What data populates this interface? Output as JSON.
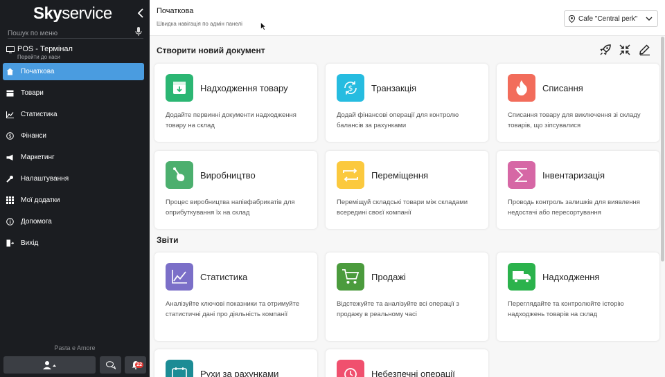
{
  "sidebar": {
    "logo_bold": "Sky",
    "logo_light": "service",
    "search_placeholder": "Пошук по меню",
    "pos": {
      "title": "POS - Термінал",
      "subtitle": "Перейти до каси"
    },
    "items": [
      {
        "label": "Початкова",
        "icon": "home-icon"
      },
      {
        "label": "Товари",
        "icon": "box-icon"
      },
      {
        "label": "Статистика",
        "icon": "chart-icon"
      },
      {
        "label": "Фінанси",
        "icon": "finance-icon"
      },
      {
        "label": "Маркетинг",
        "icon": "megaphone-icon"
      },
      {
        "label": "Налаштування",
        "icon": "wrench-icon"
      },
      {
        "label": "Мої додатки",
        "icon": "grid-icon"
      },
      {
        "label": "Допомога",
        "icon": "info-icon"
      },
      {
        "label": "Вихід",
        "icon": "logout-icon"
      }
    ],
    "company": "Pasta e Amore",
    "notifications_count": "22"
  },
  "header": {
    "title": "Початкова",
    "subtitle": "Швидка навігація по адмін панелі",
    "location": "Cafe \"Central perk\""
  },
  "main": {
    "create_title": "Створити новий документ",
    "reports_title": "Звіти",
    "docs": [
      {
        "title": "Надходження товару",
        "desc": "Додайте первинні документи надходження товару на склад",
        "color": "#2bb673"
      },
      {
        "title": "Транзакція",
        "desc": "Додай фінансові операції для контролю балансів за рахунками",
        "color": "#26bce0"
      },
      {
        "title": "Списання",
        "desc": "Списання товару для виключення зі складу товарів, що зіпсувалися",
        "color": "#f26c5b"
      },
      {
        "title": "Виробництво",
        "desc": "Процес виробництва напівфабрикатів для оприбуткування їх на склад",
        "color": "#4caf6e"
      },
      {
        "title": "Переміщення",
        "desc": "Переміщуй складські товари між складами всередині своєї компанії",
        "color": "#fbc93e"
      },
      {
        "title": "Інвентаризація",
        "desc": "Проводь контроль залишків для виявлення недостачі або пересортування",
        "color": "#d667a5"
      }
    ],
    "reports": [
      {
        "title": "Статистика",
        "desc": "Аналізуйте ключові показники та отримуйте статистичні дані про діяльність компанії",
        "color": "#7b6fc8"
      },
      {
        "title": "Продажі",
        "desc": "Відстежуйте та аналізуйте всі операції з продажу в реальному часі",
        "color": "#4b9b3d"
      },
      {
        "title": "Надходження",
        "desc": "Переглядайте та контролюйте історію надходжень товарів на склад",
        "color": "#2bb24c"
      },
      {
        "title": "Рухи за рахунками",
        "desc": "",
        "color": "#1c8c95"
      },
      {
        "title": "Небезпечні операції",
        "desc": "",
        "color": "#f0506e"
      }
    ]
  }
}
